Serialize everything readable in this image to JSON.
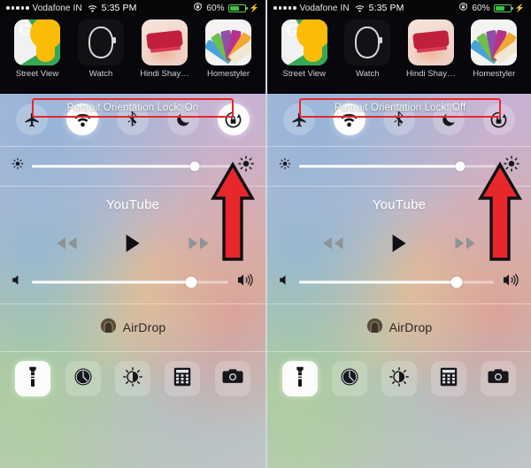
{
  "status_bar": {
    "signal_dots": 5,
    "carrier": "Vodafone IN",
    "wifi_icon": "wifi-icon",
    "time": "5:35 PM",
    "rotation_lock_icon": "rotation-lock-icon",
    "battery_percent": "60%",
    "battery_level": 60,
    "charging_icon": "lightning-bolt-icon"
  },
  "home_screen": {
    "apps": [
      {
        "label": "Street View",
        "icon": "street-view-app-icon"
      },
      {
        "label": "Watch",
        "icon": "watch-app-icon"
      },
      {
        "label": "Hindi Shay…",
        "icon": "hindi-shayari-app-icon"
      },
      {
        "label": "Homestyler",
        "icon": "homestyler-app-icon"
      }
    ]
  },
  "panels": [
    {
      "id": "left",
      "callout": "Portrait Orientation Lock: On",
      "toggles": [
        {
          "name": "airplane-mode-toggle",
          "icon": "airplane-icon",
          "state": "off"
        },
        {
          "name": "wifi-toggle",
          "icon": "wifi-icon",
          "state": "on"
        },
        {
          "name": "bluetooth-toggle",
          "icon": "bluetooth-icon",
          "state": "off"
        },
        {
          "name": "do-not-disturb-toggle",
          "icon": "moon-icon",
          "state": "off"
        },
        {
          "name": "rotation-lock-toggle",
          "icon": "rotation-lock-icon",
          "state": "on"
        }
      ],
      "brightness": {
        "value": 82,
        "low_icon": "sun-small-icon",
        "high_icon": "sun-large-icon"
      },
      "media": {
        "title": "YouTube",
        "controls": [
          {
            "name": "rewind-button",
            "icon": "rewind-icon",
            "enabled": false
          },
          {
            "name": "play-button",
            "icon": "play-icon",
            "enabled": true
          },
          {
            "name": "fast-forward-button",
            "icon": "fast-forward-icon",
            "enabled": false
          }
        ]
      },
      "volume": {
        "value": 81,
        "low_icon": "speaker-mute-icon",
        "high_icon": "speaker-loud-icon"
      },
      "airdrop": {
        "label": "AirDrop",
        "icon": "airdrop-icon"
      },
      "shortcuts": [
        {
          "name": "flashlight-shortcut",
          "icon": "flashlight-icon",
          "state": "on"
        },
        {
          "name": "timer-shortcut",
          "icon": "timer-icon",
          "state": "off"
        },
        {
          "name": "night-shift-shortcut",
          "icon": "night-shift-icon",
          "state": "off"
        },
        {
          "name": "calculator-shortcut",
          "icon": "calculator-icon",
          "state": "off"
        },
        {
          "name": "camera-shortcut",
          "icon": "camera-icon",
          "state": "off"
        }
      ]
    },
    {
      "id": "right",
      "callout": "Portrait Orientation Lock: Off",
      "toggles": [
        {
          "name": "airplane-mode-toggle",
          "icon": "airplane-icon",
          "state": "off"
        },
        {
          "name": "wifi-toggle",
          "icon": "wifi-icon",
          "state": "on"
        },
        {
          "name": "bluetooth-toggle",
          "icon": "bluetooth-icon",
          "state": "off"
        },
        {
          "name": "do-not-disturb-toggle",
          "icon": "moon-icon",
          "state": "off"
        },
        {
          "name": "rotation-lock-toggle",
          "icon": "rotation-lock-icon",
          "state": "off"
        }
      ],
      "brightness": {
        "value": 82,
        "low_icon": "sun-small-icon",
        "high_icon": "sun-large-icon"
      },
      "media": {
        "title": "YouTube",
        "controls": [
          {
            "name": "rewind-button",
            "icon": "rewind-icon",
            "enabled": false
          },
          {
            "name": "play-button",
            "icon": "play-icon",
            "enabled": true
          },
          {
            "name": "fast-forward-button",
            "icon": "fast-forward-icon",
            "enabled": false
          }
        ]
      },
      "volume": {
        "value": 81,
        "low_icon": "speaker-mute-icon",
        "high_icon": "speaker-loud-icon"
      },
      "airdrop": {
        "label": "AirDrop",
        "icon": "airdrop-icon"
      },
      "shortcuts": [
        {
          "name": "flashlight-shortcut",
          "icon": "flashlight-icon",
          "state": "on"
        },
        {
          "name": "timer-shortcut",
          "icon": "timer-icon",
          "state": "off"
        },
        {
          "name": "night-shift-shortcut",
          "icon": "night-shift-icon",
          "state": "off"
        },
        {
          "name": "calculator-shortcut",
          "icon": "calculator-icon",
          "state": "off"
        },
        {
          "name": "camera-shortcut",
          "icon": "camera-icon",
          "state": "off"
        }
      ]
    }
  ],
  "annotations": {
    "arrow_color": "#e8272d",
    "arrow_outline": "#111111",
    "callout_border_color": "#e8272d",
    "arrows": [
      {
        "name": "pointer-arrow-left",
        "points_to": "rotation-lock-toggle"
      },
      {
        "name": "pointer-arrow-right",
        "points_to": "rotation-lock-toggle"
      }
    ]
  }
}
